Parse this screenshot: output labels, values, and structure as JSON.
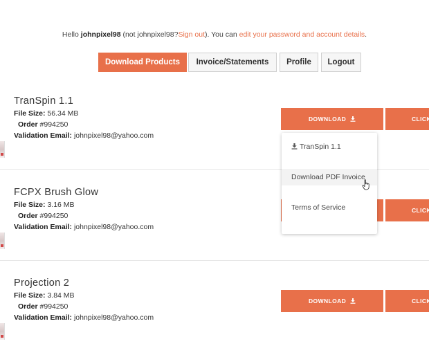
{
  "greeting": {
    "hello": "Hello",
    "username": "johnpixel98",
    "not_prefix": "(not",
    "not_user": "johnpixel98?",
    "sign_out": "Sign out",
    "mid_text": "). You can",
    "edit_link": "edit your password and account details",
    "end": "."
  },
  "tabs": [
    {
      "label": "Download Products",
      "active": true
    },
    {
      "label": "Invoice/Statements",
      "active": false
    },
    {
      "label": "Profile",
      "active": false
    },
    {
      "label": "Logout",
      "active": false
    }
  ],
  "labels": {
    "file_size": "File Size:",
    "order": "Order",
    "validation_email": "Validation Email:",
    "download_button": "DOWNLOAD",
    "click_button": "CLICK"
  },
  "products": [
    {
      "name": "TranSpin 1.1",
      "file_size": "56.34 MB",
      "order": "#994250",
      "email": "johnpixel98@yahoo.com"
    },
    {
      "name": "FCPX Brush Glow",
      "file_size": "3.16 MB",
      "order": "#994250",
      "email": "johnpixel98@yahoo.com"
    },
    {
      "name": "Projection 2",
      "file_size": "3.84 MB",
      "order": "#994250",
      "email": "johnpixel98@yahoo.com"
    }
  ],
  "dropdown": {
    "items": [
      {
        "label": "TranSpin 1.1",
        "icon": "download-icon"
      },
      {
        "label": "Download PDF Invoice",
        "icon": null
      },
      {
        "label": "Terms of Service",
        "icon": null
      }
    ]
  },
  "colors": {
    "accent": "#e8704a",
    "link": "#e8704a"
  }
}
